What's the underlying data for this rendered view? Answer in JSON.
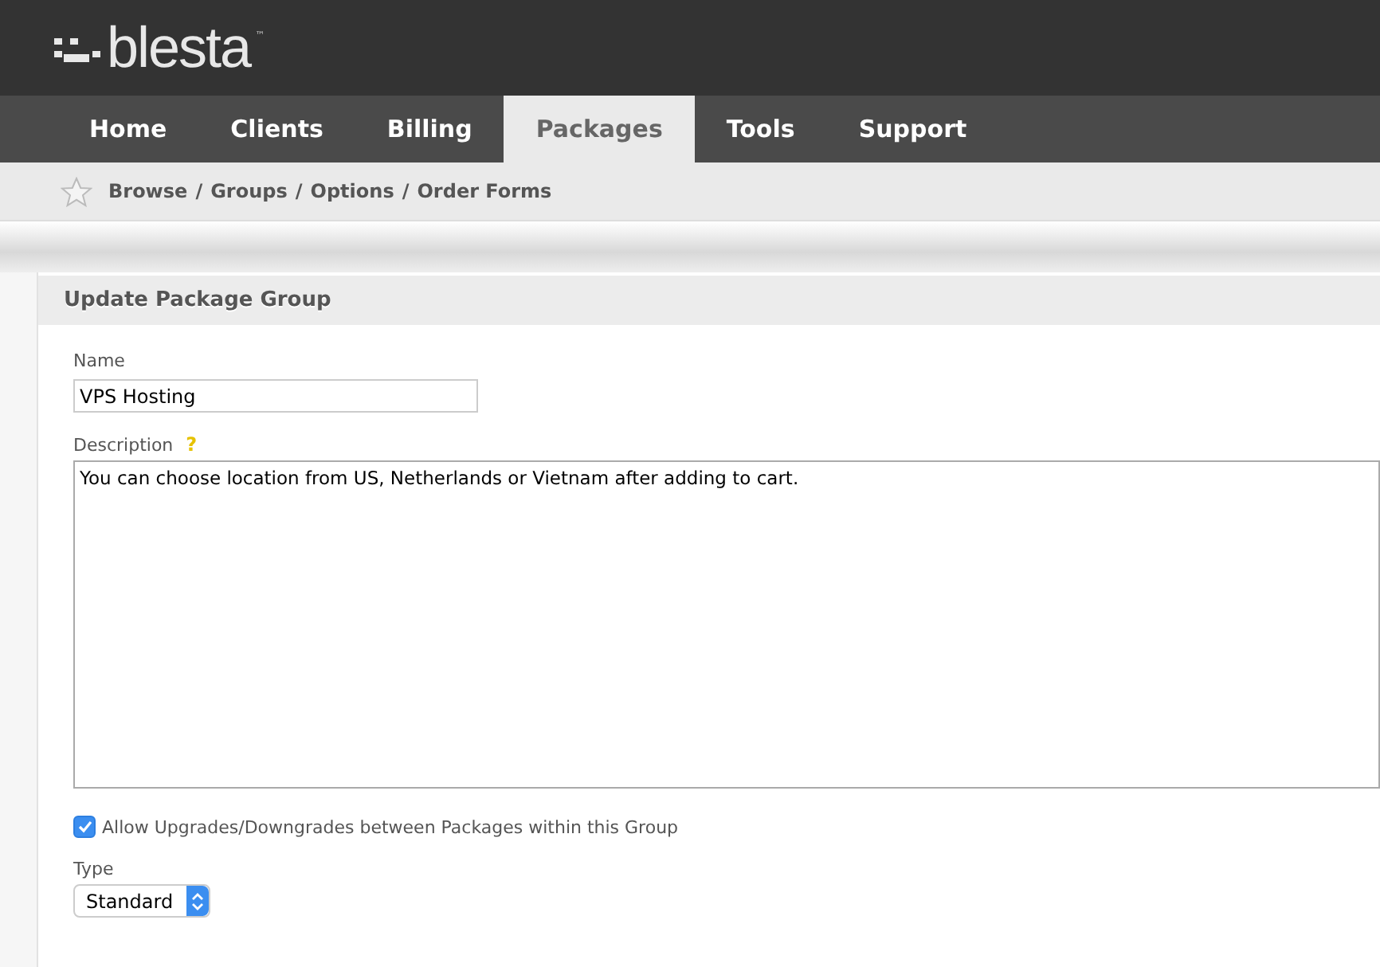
{
  "logo": {
    "text": "blesta",
    "mark": "™"
  },
  "nav": [
    {
      "label": "Home",
      "selected": false
    },
    {
      "label": "Clients",
      "selected": false
    },
    {
      "label": "Billing",
      "selected": false
    },
    {
      "label": "Packages",
      "selected": true
    },
    {
      "label": "Tools",
      "selected": false
    },
    {
      "label": "Support",
      "selected": false
    }
  ],
  "breadcrumb": [
    "Browse",
    "Groups",
    "Options",
    "Order Forms"
  ],
  "breadcrumb_separator": "/",
  "panel": {
    "title": "Update Package Group",
    "name": {
      "label": "Name",
      "value": "VPS Hosting"
    },
    "description": {
      "label": "Description",
      "help": "?",
      "value": "You can choose location from US, Netherlands or Vietnam after adding to cart."
    },
    "allow_upgrades": {
      "label": "Allow Upgrades/Downgrades between Packages within this Group",
      "checked": true
    },
    "type": {
      "label": "Type",
      "value": "Standard"
    }
  }
}
